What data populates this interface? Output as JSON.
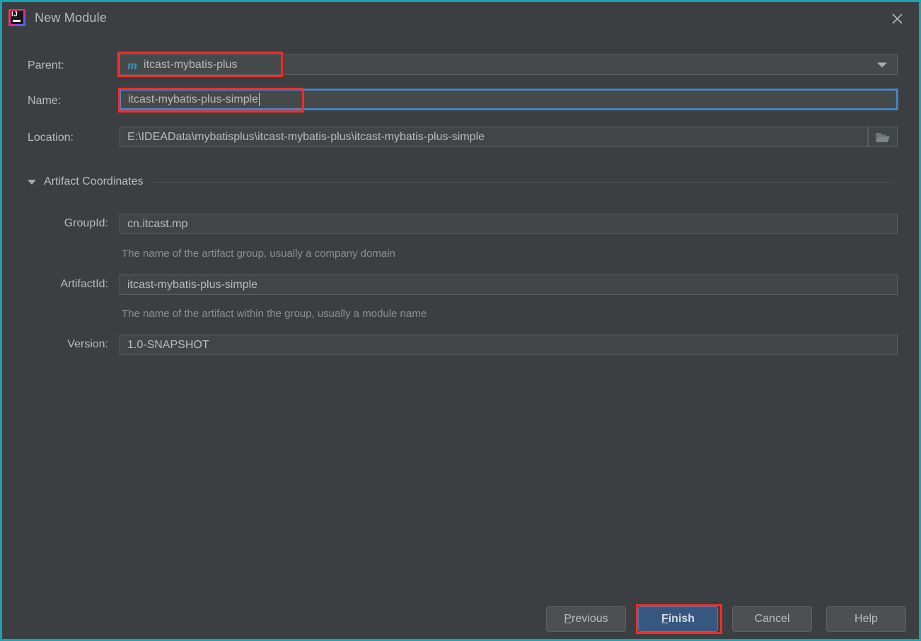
{
  "window": {
    "title": "New Module",
    "app_icon": "intellij-idea-logo",
    "close_icon": "close-icon",
    "border_color": "#1aa3b0",
    "background_color": "#3c3f41"
  },
  "form": {
    "parent": {
      "label": "Parent:",
      "value": "itcast-mybatis-plus",
      "icon": "maven-module-icon",
      "icon_glyph": "m",
      "dropdown_icon": "chevron-down-icon",
      "highlighted": true
    },
    "name": {
      "label": "Name:",
      "value": "itcast-mybatis-plus-simple",
      "focused": true,
      "highlighted": true
    },
    "location": {
      "label": "Location:",
      "value": "E:\\IDEAData\\mybatisplus\\itcast-mybatis-plus\\itcast-mybatis-plus-simple",
      "browse_icon": "folder-open-icon"
    }
  },
  "artifact_section": {
    "label": "Artifact Coordinates",
    "expanded": true,
    "toggle_icon": "triangle-down-icon",
    "fields": [
      {
        "label": "GroupId:",
        "value": "cn.itcast.mp",
        "hint": "The name of the artifact group, usually a company domain"
      },
      {
        "label": "ArtifactId:",
        "value": "itcast-mybatis-plus-simple",
        "hint": "The name of the artifact within the group, usually a module name"
      },
      {
        "label": "Version:",
        "value": "1.0-SNAPSHOT",
        "hint": ""
      }
    ]
  },
  "buttons": {
    "previous": {
      "label": "Previous",
      "mnemonic": "P"
    },
    "finish": {
      "label": "Finish",
      "mnemonic": "F",
      "primary": true,
      "highlighted": true,
      "accent_color": "#365880"
    },
    "cancel": {
      "label": "Cancel"
    },
    "help": {
      "label": "Help"
    }
  },
  "annotations": {
    "color": "#ff2a2a",
    "targets": [
      "parent-field",
      "name-field",
      "finish-button"
    ]
  }
}
